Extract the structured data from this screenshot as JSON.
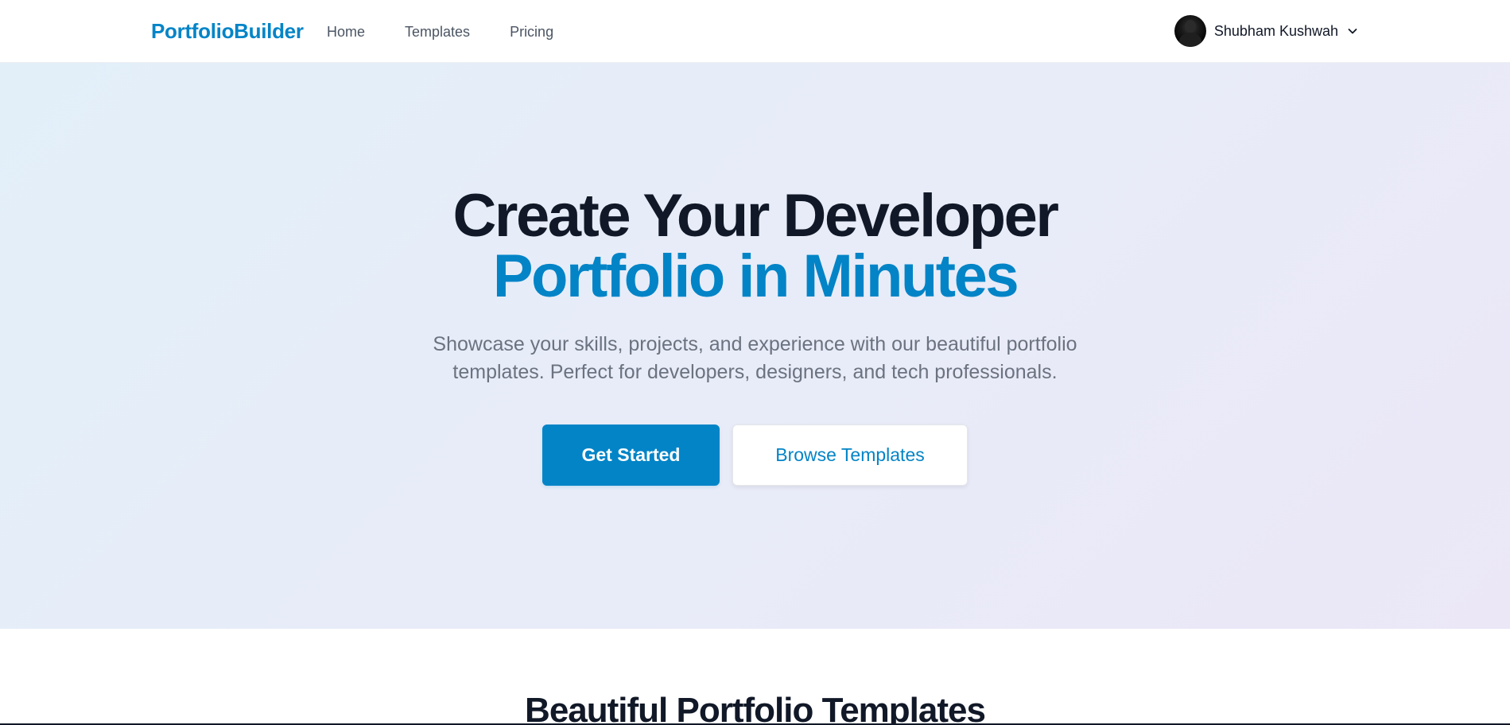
{
  "navbar": {
    "brand": "PortfolioBuilder",
    "links": [
      {
        "label": "Home"
      },
      {
        "label": "Templates"
      },
      {
        "label": "Pricing"
      }
    ],
    "user": {
      "name": "Shubham Kushwah",
      "avatar_icon": "user-avatar",
      "dropdown_icon": "chevron-down-icon"
    }
  },
  "hero": {
    "title_line1": "Create Your Developer",
    "title_line2": "Portfolio in Minutes",
    "subtitle_line1": "Showcase your skills, projects, and experience with our beautiful portfolio",
    "subtitle_line2": "templates. Perfect for developers, designers, and tech professionals.",
    "primary_button": "Get Started",
    "secondary_button": "Browse Templates"
  },
  "templates_section": {
    "title": "Beautiful Portfolio Templates"
  },
  "colors": {
    "brand": "#0284c7",
    "heading": "#111827",
    "muted": "#6b7280",
    "nav_text": "#4b5563"
  }
}
